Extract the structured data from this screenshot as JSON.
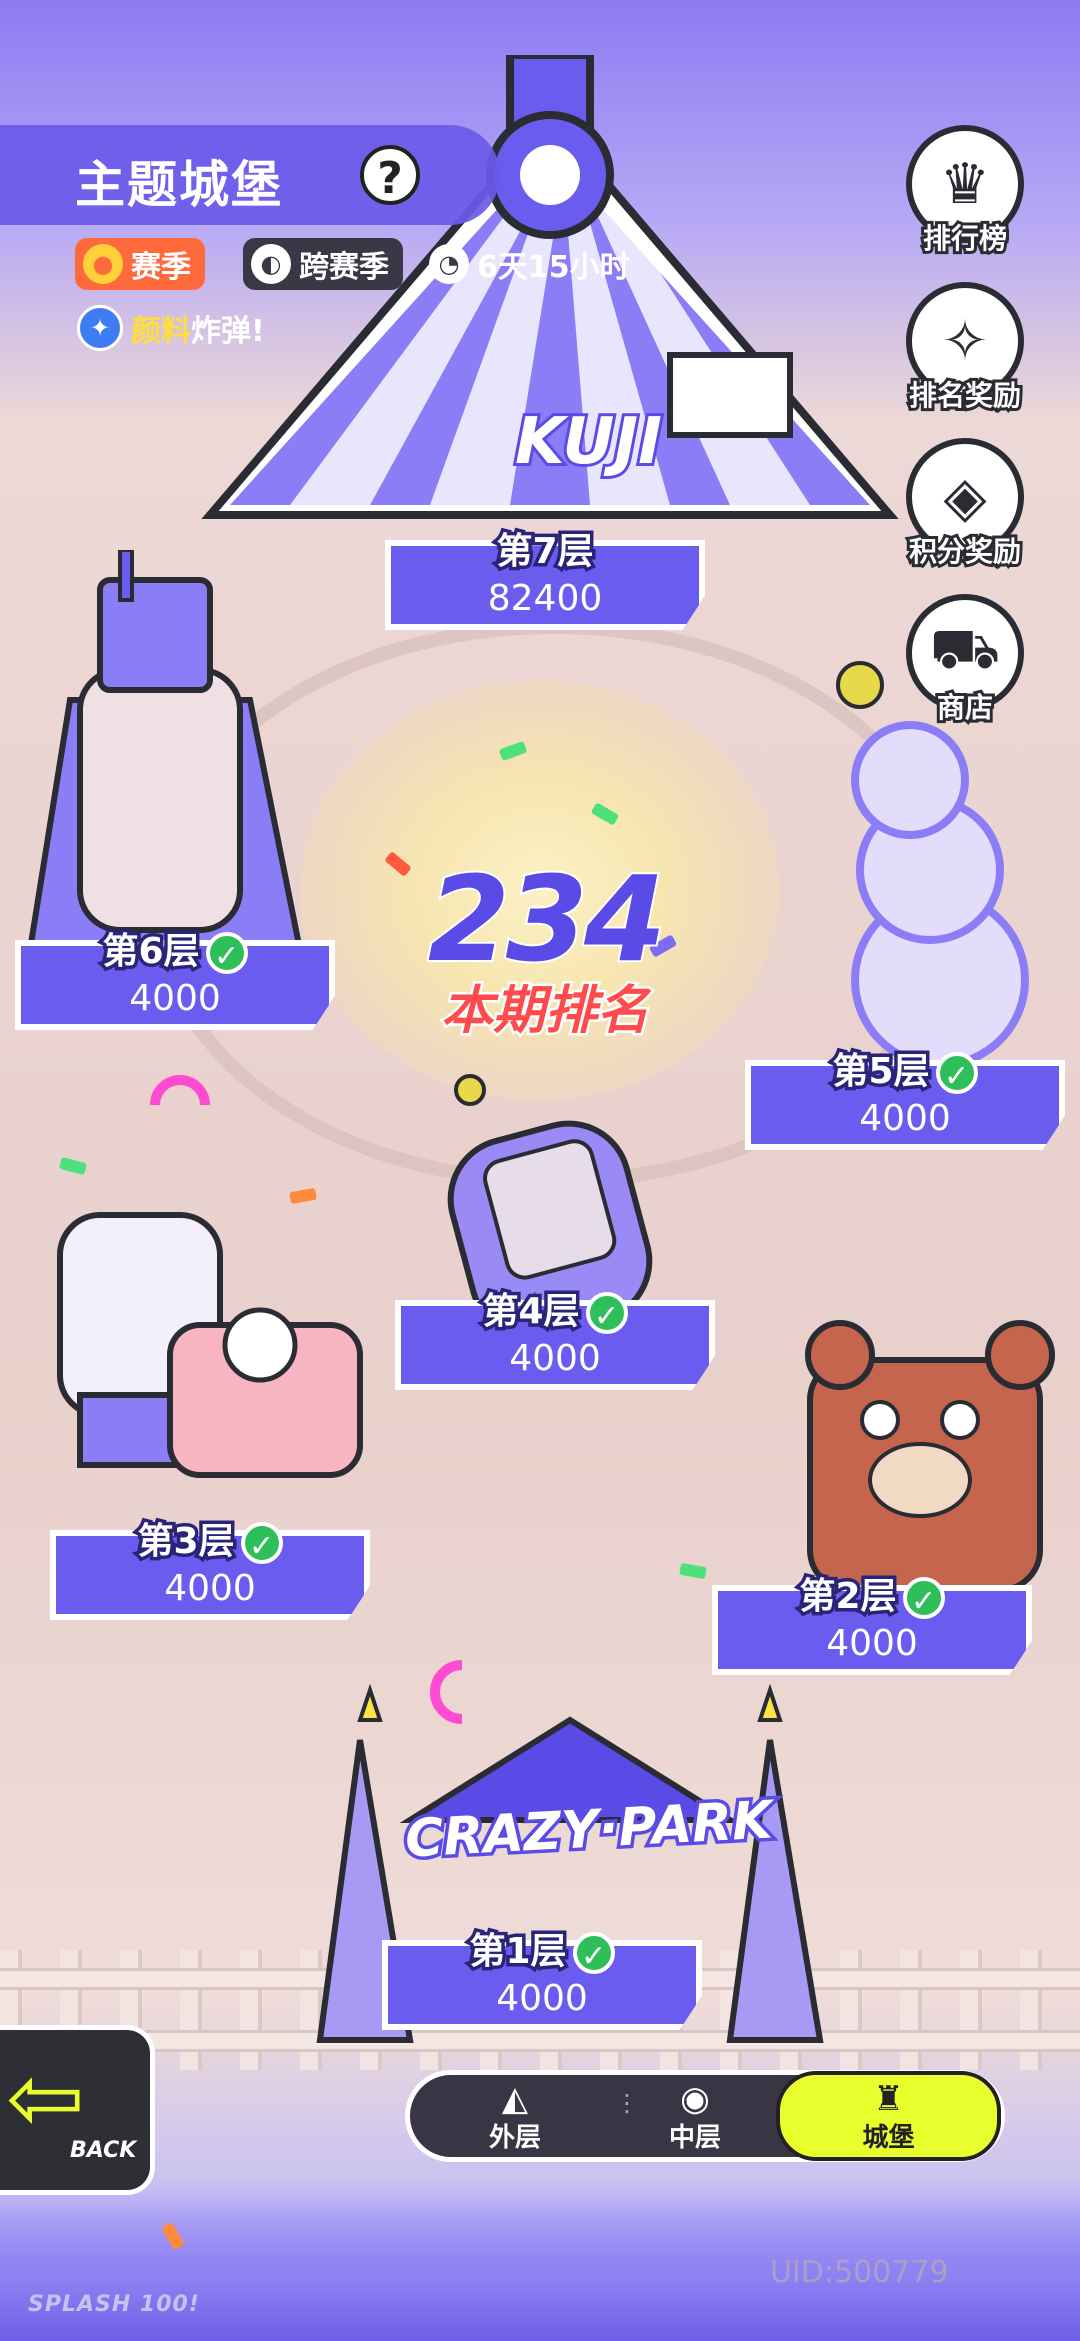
{
  "header": {
    "title": "主题城堡",
    "help": "?",
    "season_chip": "赛季",
    "cross_season_chip": "跨赛季",
    "timer": "6天15小时",
    "bomb_highlight": "颜料",
    "bomb_rest": "炸弹!"
  },
  "side_menu": [
    {
      "label": "排行榜",
      "icon": "trophy-icon"
    },
    {
      "label": "排名奖励",
      "icon": "gift-box-icon"
    },
    {
      "label": "积分奖励",
      "icon": "reward-box-icon"
    },
    {
      "label": "商店",
      "icon": "cart-icon"
    }
  ],
  "ranking": {
    "number": "234",
    "label": "本期排名"
  },
  "floors": [
    {
      "name": "第7层",
      "score": "82400",
      "completed": false
    },
    {
      "name": "第6层",
      "score": "4000",
      "completed": true
    },
    {
      "name": "第5层",
      "score": "4000",
      "completed": true
    },
    {
      "name": "第4层",
      "score": "4000",
      "completed": true
    },
    {
      "name": "第3层",
      "score": "4000",
      "completed": true
    },
    {
      "name": "第2层",
      "score": "4000",
      "completed": true
    },
    {
      "name": "第1层",
      "score": "4000",
      "completed": true
    }
  ],
  "signs": {
    "tent": "KUJI",
    "gate": "CRAZY·PARK"
  },
  "nav": {
    "outer": "外层",
    "middle": "中层",
    "castle": "城堡"
  },
  "back": "BACK",
  "uid": "UID:500779",
  "brand": "SPLASH 100!",
  "colors": {
    "accent": "#6b5cf0",
    "active_tab": "#e8ff2d",
    "rank_label": "#ff4b4b",
    "check": "#2fbf5a"
  }
}
